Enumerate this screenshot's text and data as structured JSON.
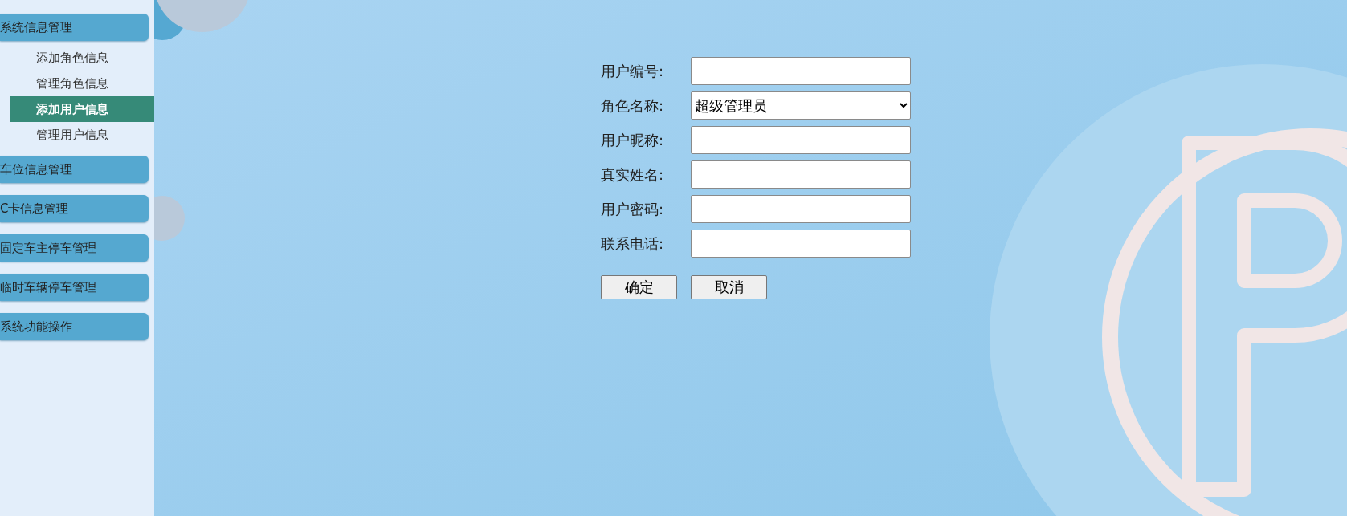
{
  "sidebar": {
    "groups": [
      {
        "title": "系统信息管理",
        "items": [
          {
            "label": "添加角色信息",
            "selected": false
          },
          {
            "label": "管理角色信息",
            "selected": false
          },
          {
            "label": "添加用户信息",
            "selected": true
          },
          {
            "label": "管理用户信息",
            "selected": false
          }
        ]
      },
      {
        "title": "车位信息管理"
      },
      {
        "title": "C卡信息管理"
      },
      {
        "title": "固定车主停车管理"
      },
      {
        "title": "临时车辆停车管理"
      },
      {
        "title": "系统功能操作"
      }
    ]
  },
  "form": {
    "fields": [
      {
        "label": "用户编号:",
        "kind": "text"
      },
      {
        "label": "角色名称:",
        "kind": "select",
        "value": "超级管理员"
      },
      {
        "label": "用户昵称:",
        "kind": "text"
      },
      {
        "label": "真实姓名:",
        "kind": "text"
      },
      {
        "label": "用户密码:",
        "kind": "password"
      },
      {
        "label": "联系电话:",
        "kind": "text"
      }
    ],
    "buttons": [
      "确定",
      "取消"
    ]
  }
}
